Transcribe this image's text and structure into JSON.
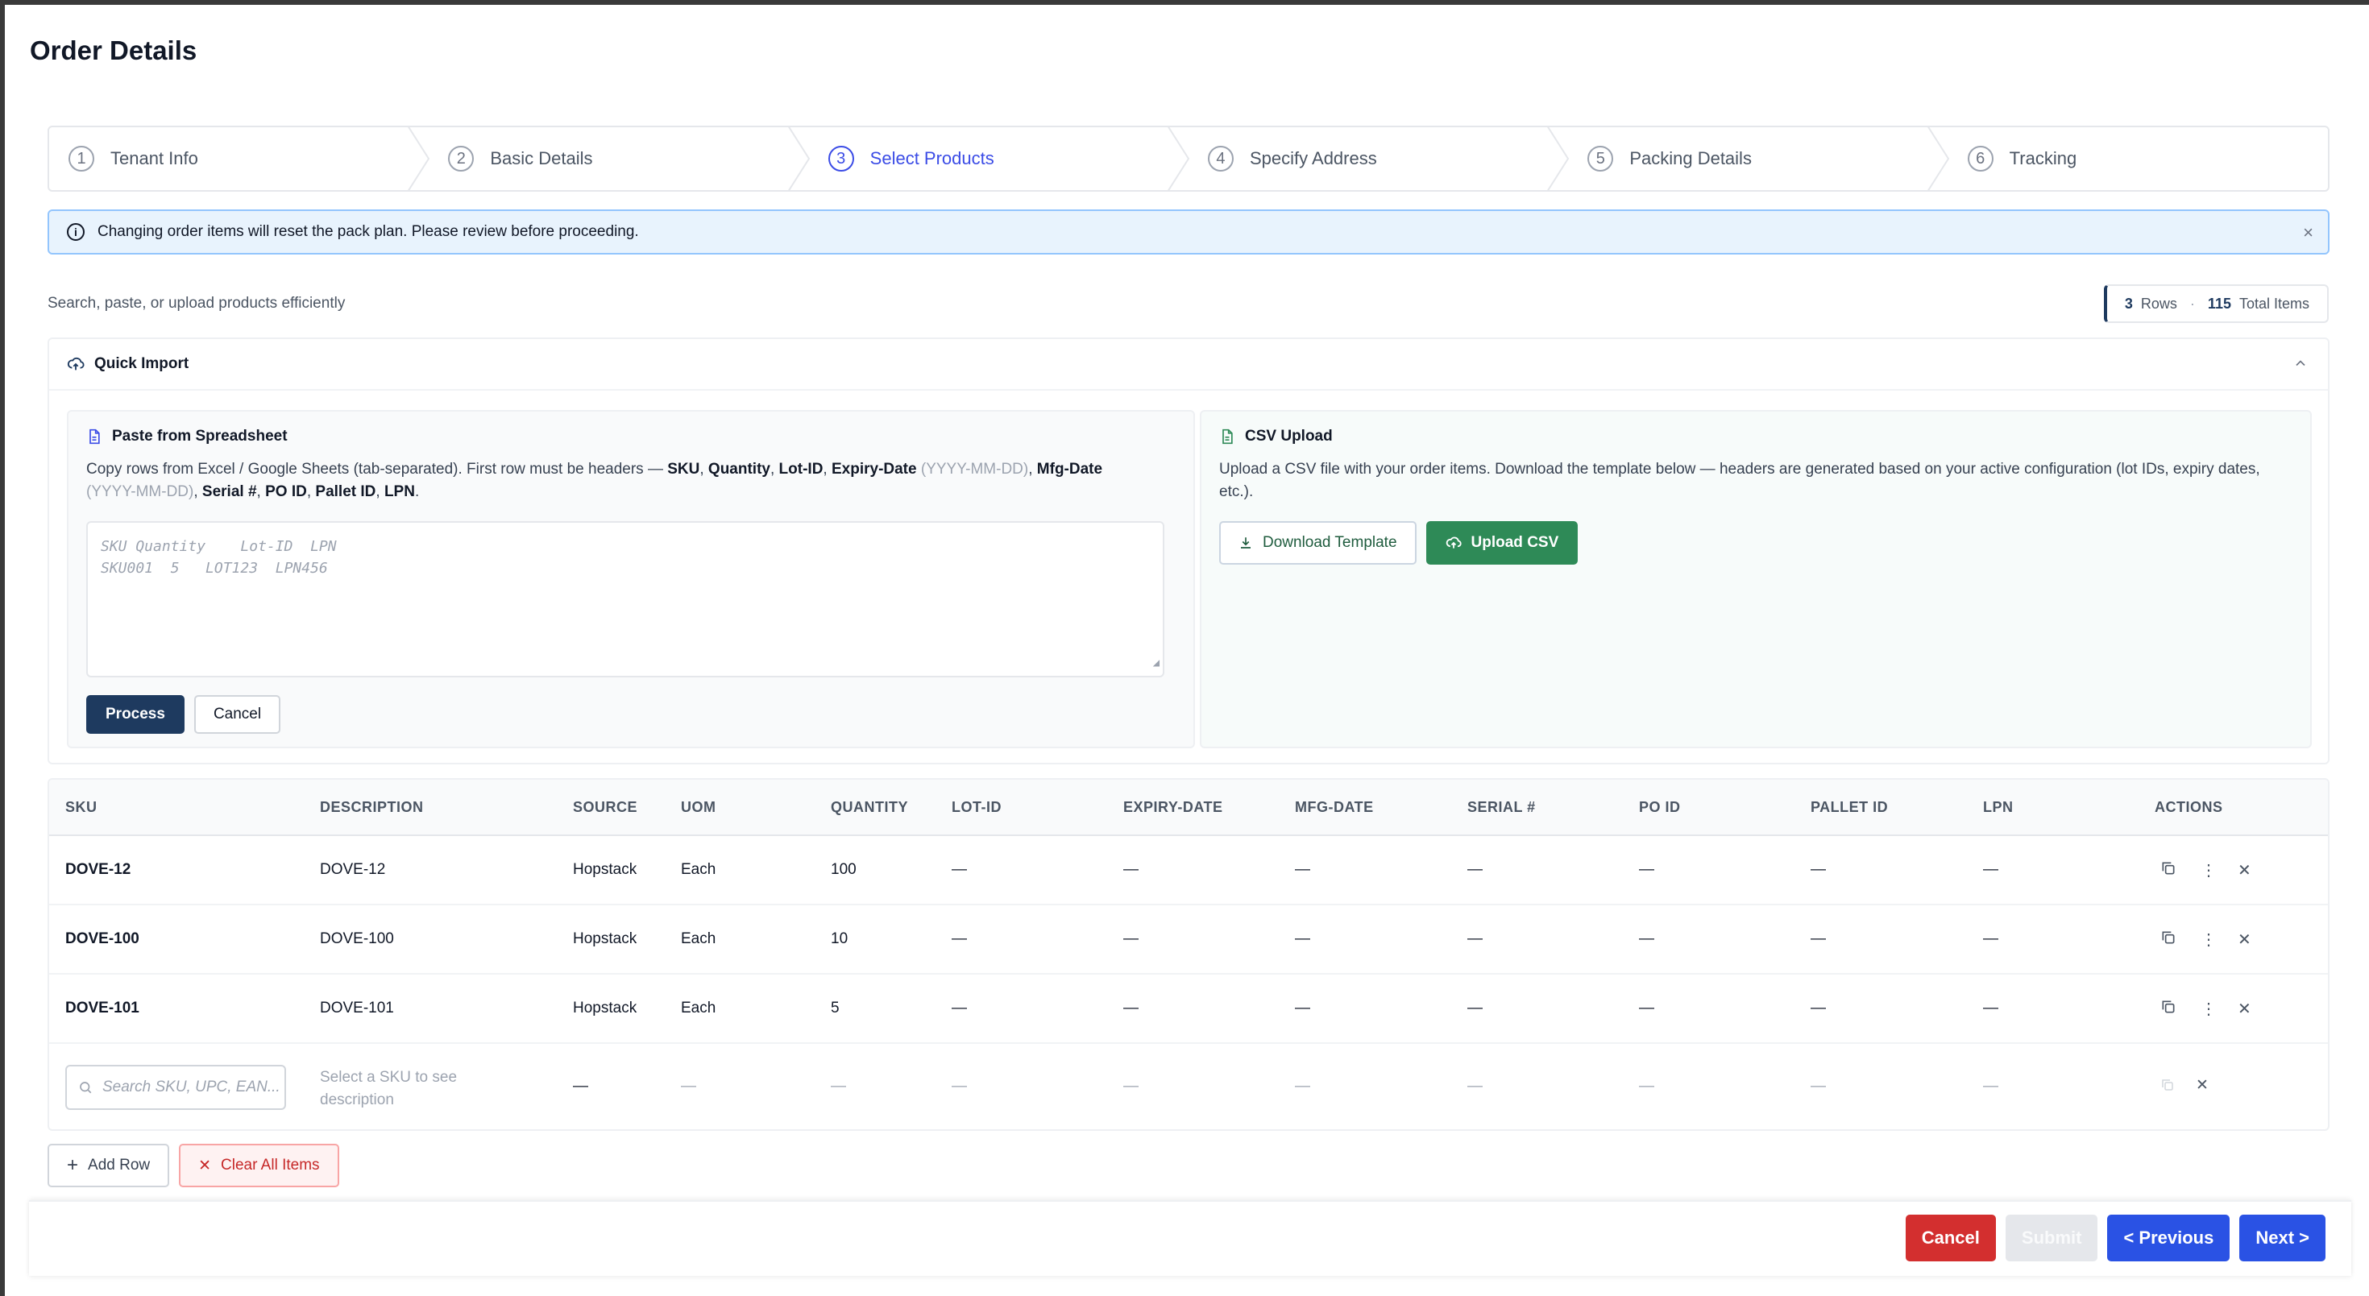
{
  "page": {
    "title": "Order Details"
  },
  "stepper": [
    {
      "num": "1",
      "label": "Tenant Info"
    },
    {
      "num": "2",
      "label": "Basic Details"
    },
    {
      "num": "3",
      "label": "Select Products"
    },
    {
      "num": "4",
      "label": "Specify Address"
    },
    {
      "num": "5",
      "label": "Packing Details"
    },
    {
      "num": "6",
      "label": "Tracking"
    }
  ],
  "active_step": 3,
  "alert": {
    "icon": "info-icon",
    "text": "Changing order items will reset the pack plan. Please review before proceeding.",
    "close": "×"
  },
  "subtitle": "Search, paste, or upload products efficiently",
  "counter": {
    "rows_value": "3",
    "rows_label": "Rows",
    "dot": "·",
    "total_value": "115",
    "total_label": "Total Items"
  },
  "quick_import": {
    "title": "Quick Import",
    "paste": {
      "title": "Paste from Spreadsheet",
      "desc_prefix": "Copy rows from Excel / Google Sheets (tab-separated). First row must be headers — ",
      "h_sku": "SKU",
      "h_qty": "Quantity",
      "h_lot": "Lot-ID",
      "h_exp": "Expiry-Date",
      "h_exp_fmt": "(YYYY-MM-DD)",
      "h_mfg": "Mfg-Date",
      "h_mfg_fmt": "(YYYY-MM-DD)",
      "h_serial": "Serial #",
      "h_po": "PO ID",
      "h_pallet": "Pallet ID",
      "h_lpn": "LPN",
      "placeholder": "SKU Quantity    Lot-ID  LPN\nSKU001  5   LOT123  LPN456",
      "process": "Process",
      "cancel": "Cancel"
    },
    "csv": {
      "title": "CSV Upload",
      "desc": "Upload a CSV file with your order items. Download the template below — headers are generated based on your active configuration (lot IDs, expiry dates, etc.).",
      "download": "Download Template",
      "upload": "Upload CSV"
    }
  },
  "table": {
    "headers": [
      "SKU",
      "DESCRIPTION",
      "SOURCE",
      "UOM",
      "QUANTITY",
      "LOT-ID",
      "EXPIRY-DATE",
      "MFG-DATE",
      "SERIAL #",
      "PO ID",
      "PALLET ID",
      "LPN",
      "ACTIONS"
    ],
    "rows": [
      {
        "sku": "DOVE-12",
        "description": "DOVE-12",
        "source": "Hopstack",
        "uom": "Each",
        "quantity": "100",
        "lot": "—",
        "expiry": "—",
        "mfg": "—",
        "serial": "—",
        "po": "—",
        "pallet": "—",
        "lpn": "—"
      },
      {
        "sku": "DOVE-100",
        "description": "DOVE-100",
        "source": "Hopstack",
        "uom": "Each",
        "quantity": "10",
        "lot": "—",
        "expiry": "—",
        "mfg": "—",
        "serial": "—",
        "po": "—",
        "pallet": "—",
        "lpn": "—"
      },
      {
        "sku": "DOVE-101",
        "description": "DOVE-101",
        "source": "Hopstack",
        "uom": "Each",
        "quantity": "5",
        "lot": "—",
        "expiry": "—",
        "mfg": "—",
        "serial": "—",
        "po": "—",
        "pallet": "—",
        "lpn": "—"
      }
    ],
    "new_row": {
      "search_placeholder": "Search SKU, UPC, EAN...",
      "desc_line1": "Select a SKU to see",
      "desc_line2": "description",
      "source": "—",
      "dash": "—"
    }
  },
  "actions": {
    "add_row": "Add Row",
    "clear_all": "Clear All Items"
  },
  "footer": {
    "cancel": "Cancel",
    "submit": "Submit",
    "previous": "< Previous",
    "next": "Next >"
  },
  "colors": {
    "accent": "#3b4ce6",
    "primary_dark": "#1e3a5f",
    "green": "#2e8a57",
    "danger": "#d32f2f",
    "blue": "#2a52e4"
  }
}
